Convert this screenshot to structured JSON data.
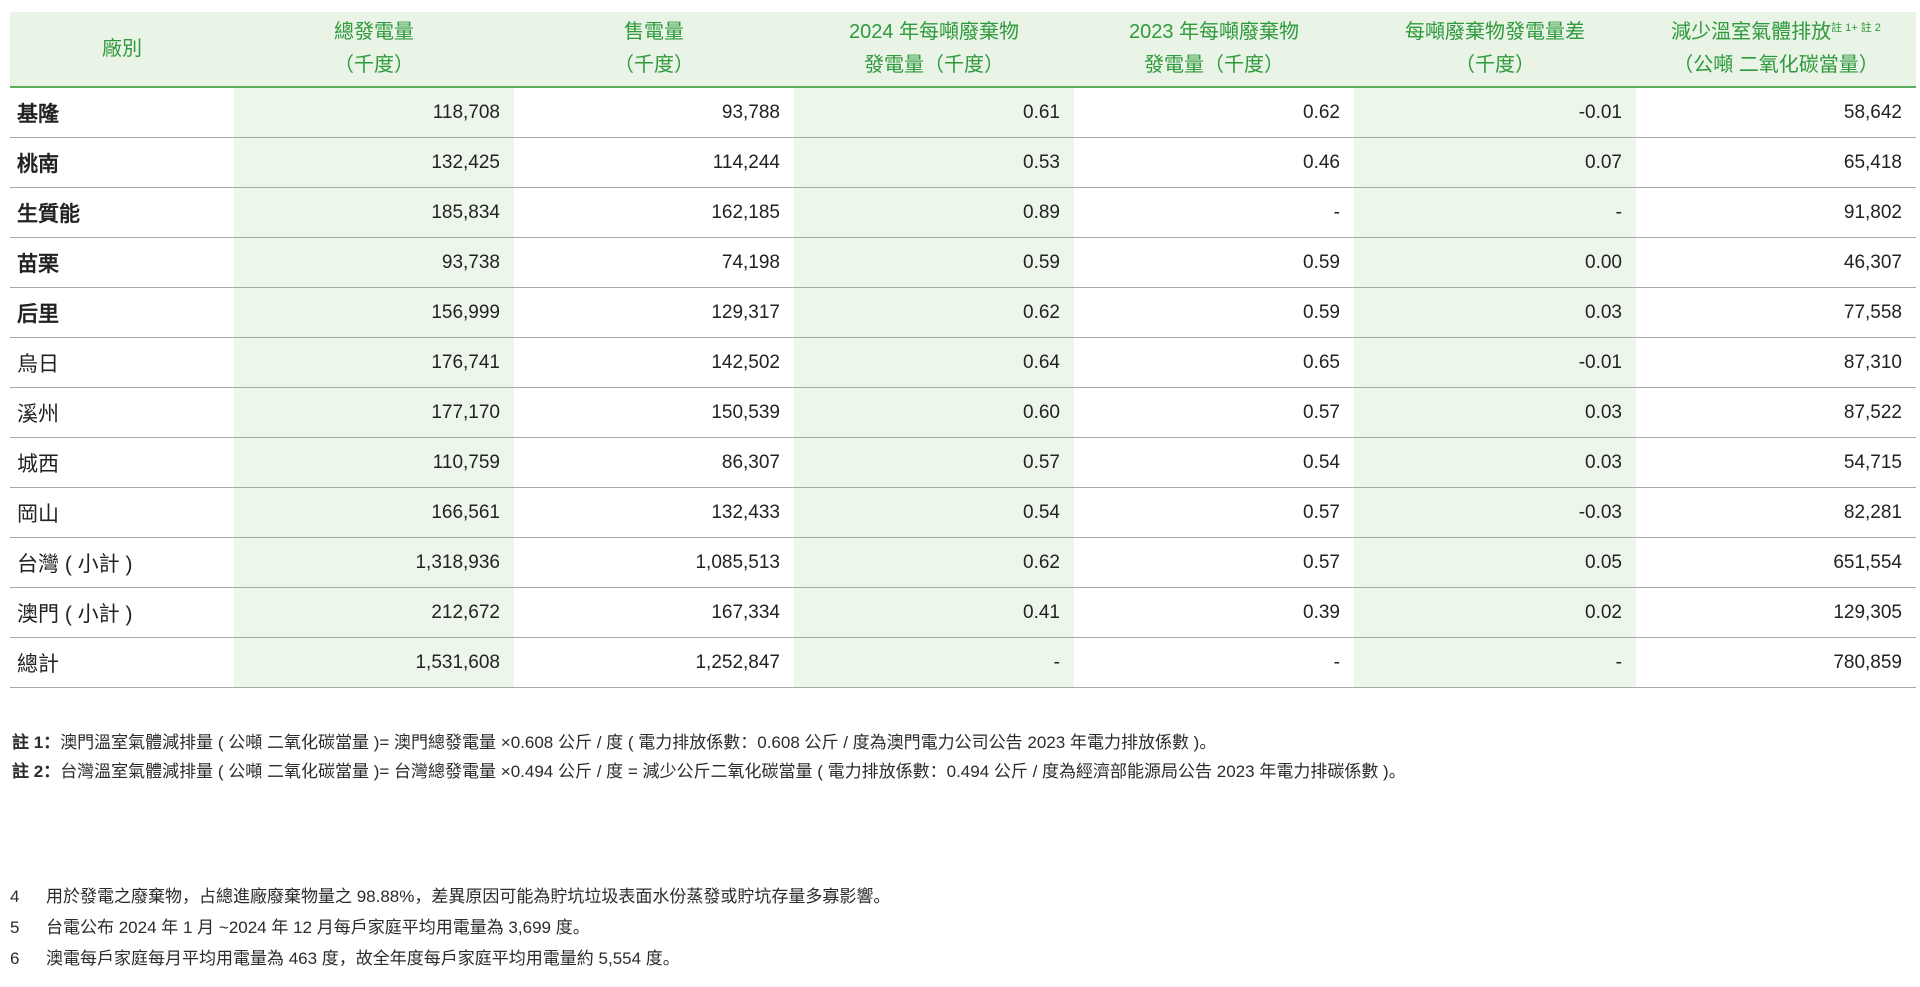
{
  "table": {
    "headers": [
      {
        "line1": "廠別",
        "line2": "",
        "sup": ""
      },
      {
        "line1": "總發電量",
        "line2": "（千度）",
        "sup": ""
      },
      {
        "line1": "售電量",
        "line2": "（千度）",
        "sup": ""
      },
      {
        "line1": "2024 年每噸廢棄物",
        "line2": "發電量（千度）",
        "sup": ""
      },
      {
        "line1": "2023 年每噸廢棄物",
        "line2": "發電量（千度）",
        "sup": ""
      },
      {
        "line1": "每噸廢棄物發電量差",
        "line2": "（千度）",
        "sup": ""
      },
      {
        "line1": "減少溫室氣體排放",
        "line2": "（公噸 二氧化碳當量）",
        "sup": "註 1+ 註 2"
      }
    ],
    "rows": [
      {
        "name": "基隆",
        "bold": true,
        "cells": [
          "118,708",
          "93,788",
          "0.61",
          "0.62",
          "-0.01",
          "58,642"
        ]
      },
      {
        "name": "桃南",
        "bold": true,
        "cells": [
          "132,425",
          "114,244",
          "0.53",
          "0.46",
          "0.07",
          "65,418"
        ]
      },
      {
        "name": "生質能",
        "bold": true,
        "cells": [
          "185,834",
          "162,185",
          "0.89",
          "-",
          "-",
          "91,802"
        ]
      },
      {
        "name": "苗栗",
        "bold": true,
        "cells": [
          "93,738",
          "74,198",
          "0.59",
          "0.59",
          "0.00",
          "46,307"
        ]
      },
      {
        "name": "后里",
        "bold": true,
        "cells": [
          "156,999",
          "129,317",
          "0.62",
          "0.59",
          "0.03",
          "77,558"
        ]
      },
      {
        "name": "烏日",
        "bold": false,
        "cells": [
          "176,741",
          "142,502",
          "0.64",
          "0.65",
          "-0.01",
          "87,310"
        ]
      },
      {
        "name": "溪州",
        "bold": false,
        "cells": [
          "177,170",
          "150,539",
          "0.60",
          "0.57",
          "0.03",
          "87,522"
        ]
      },
      {
        "name": "城西",
        "bold": false,
        "cells": [
          "110,759",
          "86,307",
          "0.57",
          "0.54",
          "0.03",
          "54,715"
        ]
      },
      {
        "name": "岡山",
        "bold": false,
        "cells": [
          "166,561",
          "132,433",
          "0.54",
          "0.57",
          "-0.03",
          "82,281"
        ]
      },
      {
        "name": "台灣 ( 小計 )",
        "bold": false,
        "cells": [
          "1,318,936",
          "1,085,513",
          "0.62",
          "0.57",
          "0.05",
          "651,554"
        ]
      },
      {
        "name": "澳門 ( 小計 )",
        "bold": false,
        "cells": [
          "212,672",
          "167,334",
          "0.41",
          "0.39",
          "0.02",
          "129,305"
        ]
      },
      {
        "name": "總計",
        "bold": false,
        "cells": [
          "1,531,608",
          "1,252,847",
          "-",
          "-",
          "-",
          "780,859"
        ]
      }
    ]
  },
  "notes": [
    {
      "label": "註 1：",
      "text": "澳門溫室氣體減排量 ( 公噸 二氧化碳當量 )= 澳門總發電量 ×0.608 公斤 / 度 ( 電力排放係數：0.608 公斤 / 度為澳門電力公司公告 2023 年電力排放係數 )。"
    },
    {
      "label": "註 2：",
      "text": "台灣溫室氣體減排量 ( 公噸 二氧化碳當量 )= 台灣總發電量 ×0.494 公斤 / 度 = 減少公斤二氧化碳當量 ( 電力排放係數：0.494 公斤 / 度為經濟部能源局公告 2023 年電力排碳係數 )。"
    }
  ],
  "footnotes": [
    {
      "num": "4",
      "text": "用於發電之廢棄物，占總進廠廢棄物量之 98.88%，差異原因可能為貯坑垃圾表面水份蒸發或貯坑存量多寡影響。"
    },
    {
      "num": "5",
      "text": "台電公布 2024 年 1 月 ~2024 年 12 月每戶家庭平均用電量為 3,699 度。"
    },
    {
      "num": "6",
      "text": "澳電每戶家庭每月平均用電量為 463 度，故全年度每戶家庭平均用電量約 5,554 度。"
    }
  ],
  "colors": {
    "header_bg": "#e9f3e6",
    "header_text": "#2e9a3c",
    "header_rule": "#5cae5e",
    "shaded_column_bg": "#edf6ea",
    "row_rule": "#a9a9a9"
  }
}
